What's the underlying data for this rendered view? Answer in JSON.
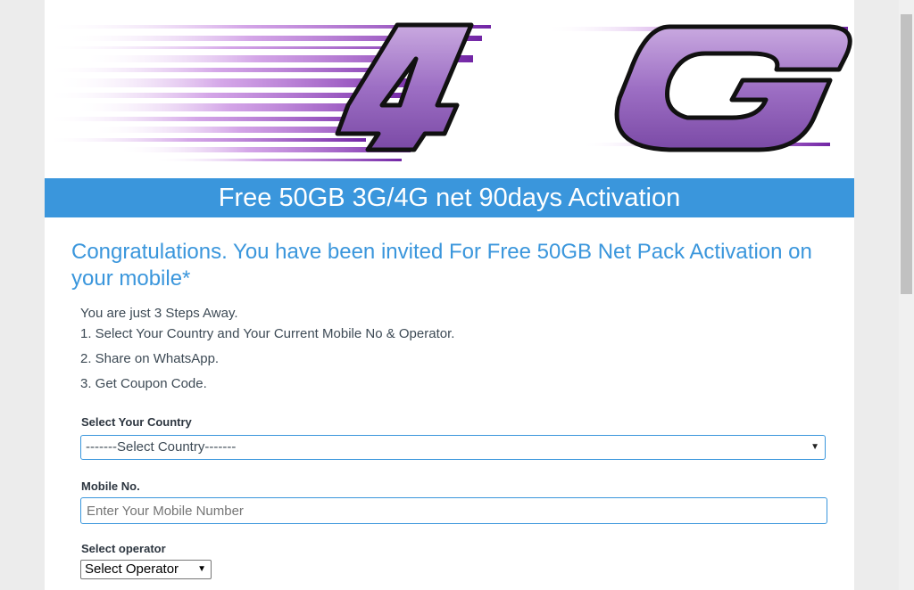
{
  "banner": {
    "logo_text": "4G"
  },
  "title_bar": {
    "text": "Free 50GB 3G/4G net 90days Activation"
  },
  "headline": {
    "text": "Congratulations. You have been invited For Free 50GB Net Pack Activation on your mobile*"
  },
  "steps": {
    "intro": "You are just 3 Steps Away.",
    "items": [
      "1. Select Your Country and Your Current Mobile No & Operator.",
      "2. Share on WhatsApp.",
      "3. Get Coupon Code."
    ]
  },
  "form": {
    "country_label": "Select Your Country",
    "country_value": "-------Select Country-------",
    "mobile_label": "Mobile No.",
    "mobile_placeholder": "Enter Your Mobile Number",
    "operator_label": "Select operator",
    "operator_value": "Select Operator"
  },
  "colors": {
    "accent": "#3a96dc",
    "logo_purple": "#8a4bb0"
  }
}
